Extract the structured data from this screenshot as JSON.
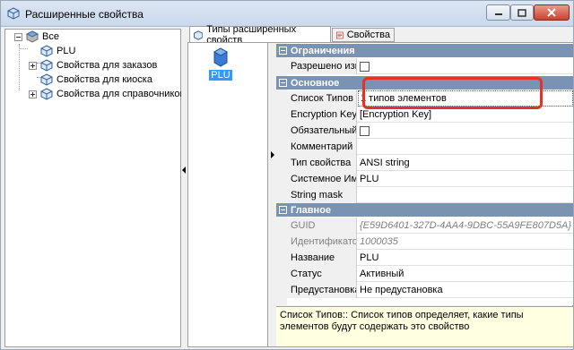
{
  "window": {
    "title": "Расширенные свойства",
    "icon": "cube-icon",
    "buttons": [
      "minimize-icon",
      "maximize-icon",
      "close-icon"
    ]
  },
  "tree": {
    "items": [
      {
        "label": "Все",
        "level": 0,
        "expander": "minus"
      },
      {
        "label": "PLU",
        "level": 1,
        "expander": "none"
      },
      {
        "label": "Свойства для заказов",
        "level": 1,
        "expander": "plus"
      },
      {
        "label": "Свойства для киоска",
        "level": 1,
        "expander": "none"
      },
      {
        "label": "Свойства для справочников",
        "level": 1,
        "expander": "plus"
      }
    ]
  },
  "tabs": [
    {
      "label": "Типы расширенных свойств",
      "active": true
    },
    {
      "label": "Свойства",
      "active": false
    }
  ],
  "types_list": {
    "items": [
      {
        "label": "PLU",
        "selected": true
      }
    ]
  },
  "property_grid": {
    "categories": [
      {
        "title": "Ограничения",
        "props": [
          {
            "name": "Разрешено изм",
            "value": "",
            "checkbox": true
          }
        ]
      },
      {
        "title": "Основное",
        "props": [
          {
            "name": "Список Типов",
            "value": "1 типов элементов",
            "selected": true
          },
          {
            "name": "Encryption Key",
            "value": "[Encryption Key]"
          },
          {
            "name": "Обязательный",
            "value": "",
            "checkbox": true
          },
          {
            "name": "Комментарий",
            "value": ""
          },
          {
            "name": "Тип свойства",
            "value": "ANSI string"
          },
          {
            "name": "Системное Имя",
            "value": "PLU"
          },
          {
            "name": "String mask",
            "value": ""
          }
        ]
      },
      {
        "title": "Главное",
        "props": [
          {
            "name": "GUID",
            "value": "{E59D6401-327D-4AA4-9DBC-55A9FE807D5A}",
            "disabled": true
          },
          {
            "name": "Идентификатор",
            "value": "1000035",
            "disabled": true
          },
          {
            "name": "Название",
            "value": "PLU"
          },
          {
            "name": "Статус",
            "value": "Активный"
          },
          {
            "name": "Предустановка",
            "value": "Не предустановка"
          }
        ]
      }
    ]
  },
  "description": "Список Типов:: Список типов определяет, какие типы элементов будут содержать это свойство",
  "colors": {
    "category_header": "#7a93b3",
    "selection": "#3399ff",
    "highlight": "#e2322a",
    "description_bg": "#ffffe1"
  }
}
